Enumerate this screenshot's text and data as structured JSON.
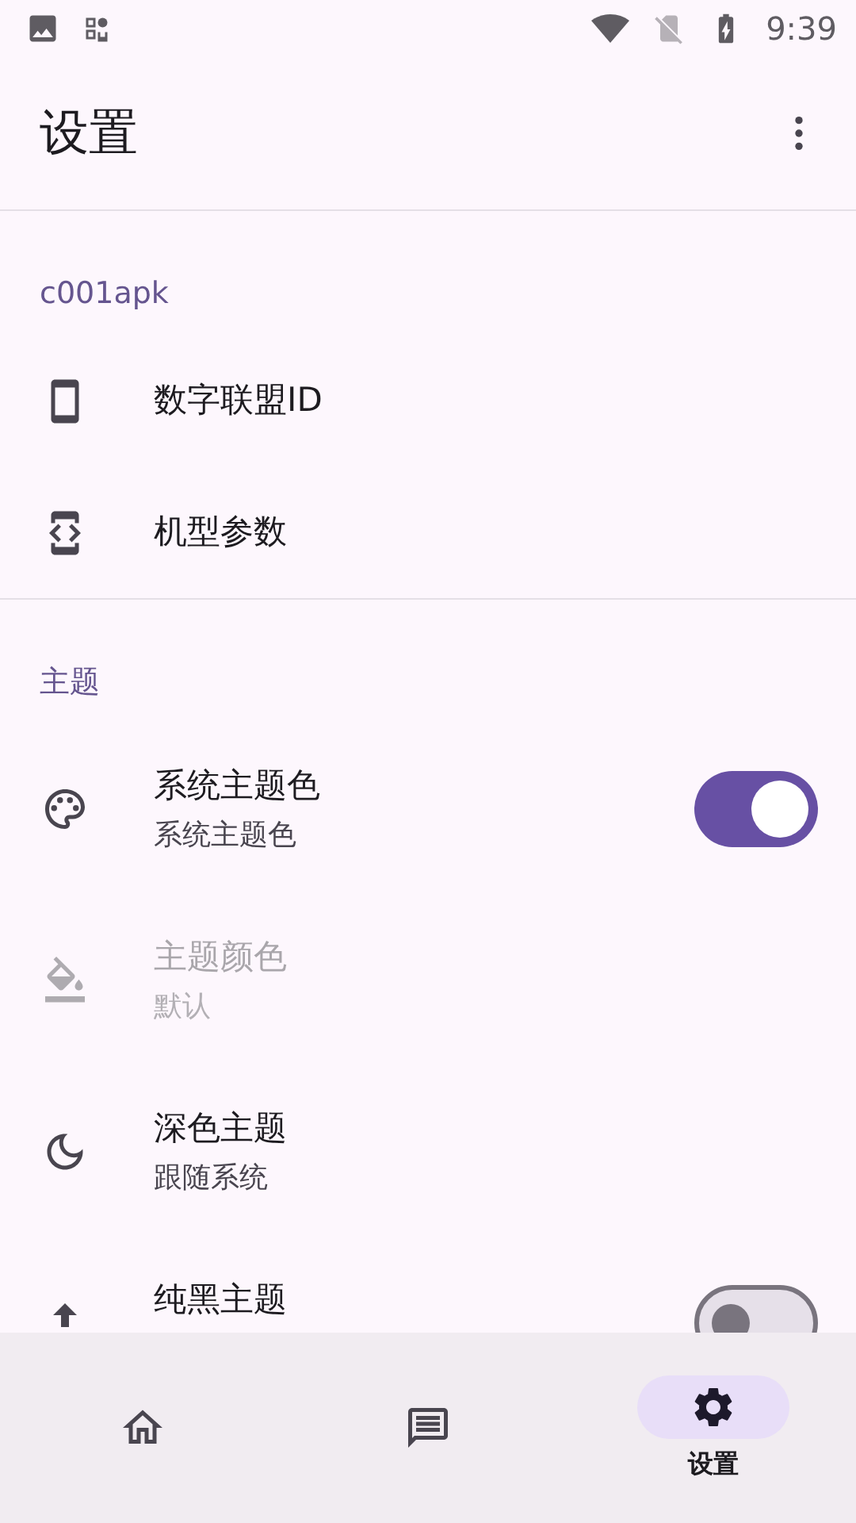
{
  "status_bar": {
    "time": "9:39"
  },
  "app_bar": {
    "title": "设置"
  },
  "sections": [
    {
      "header": "c001apk",
      "items": [
        {
          "kind": "simple",
          "title": "数字联盟ID",
          "disabled": false
        },
        {
          "kind": "simple",
          "title": "机型参数",
          "disabled": false
        }
      ]
    },
    {
      "header": "主题",
      "items": [
        {
          "kind": "switch",
          "title": "系统主题色",
          "summary": "系统主题色",
          "checked": true,
          "disabled": false
        },
        {
          "kind": "info",
          "title": "主题颜色",
          "summary": "默认",
          "disabled": true
        },
        {
          "kind": "info",
          "title": "深色主题",
          "summary": "跟随系统",
          "disabled": false
        },
        {
          "kind": "switch",
          "title": "纯黑主题",
          "checked": false,
          "disabled": false
        }
      ]
    }
  ],
  "nav": [
    {
      "selected": false
    },
    {
      "selected": false
    },
    {
      "selected": true,
      "label": "设置"
    }
  ]
}
